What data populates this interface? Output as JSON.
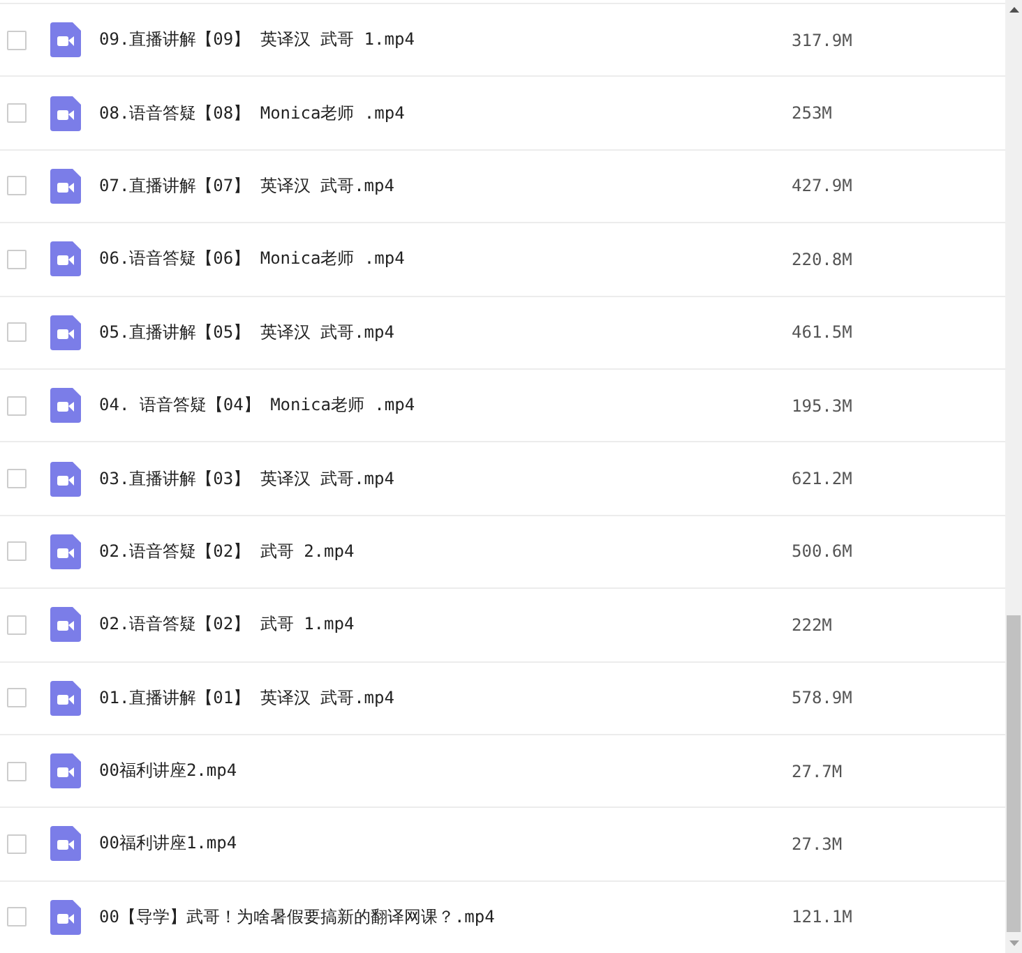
{
  "files": [
    {
      "name": "09.直播讲解【09】 英译汉 武哥 1.mp4",
      "size": "317.9M",
      "checked": false
    },
    {
      "name": "08.语音答疑【08】 Monica老师 .mp4",
      "size": "253M",
      "checked": false
    },
    {
      "name": "07.直播讲解【07】 英译汉 武哥.mp4",
      "size": "427.9M",
      "checked": false
    },
    {
      "name": "06.语音答疑【06】 Monica老师 .mp4",
      "size": "220.8M",
      "checked": false
    },
    {
      "name": "05.直播讲解【05】 英译汉 武哥.mp4",
      "size": "461.5M",
      "checked": false
    },
    {
      "name": "04. 语音答疑【04】 Monica老师 .mp4",
      "size": "195.3M",
      "checked": false
    },
    {
      "name": "03.直播讲解【03】 英译汉 武哥.mp4",
      "size": "621.2M",
      "checked": false
    },
    {
      "name": "02.语音答疑【02】 武哥 2.mp4",
      "size": "500.6M",
      "checked": false
    },
    {
      "name": "02.语音答疑【02】 武哥 1.mp4",
      "size": "222M",
      "checked": false
    },
    {
      "name": "01.直播讲解【01】 英译汉 武哥.mp4",
      "size": "578.9M",
      "checked": false
    },
    {
      "name": "00福利讲座2.mp4",
      "size": "27.7M",
      "checked": false
    },
    {
      "name": "00福利讲座1.mp4",
      "size": "27.3M",
      "checked": false
    },
    {
      "name": "00【导学】武哥！为啥暑假要搞新的翻译网课？.mp4",
      "size": "121.1M",
      "checked": false
    }
  ]
}
